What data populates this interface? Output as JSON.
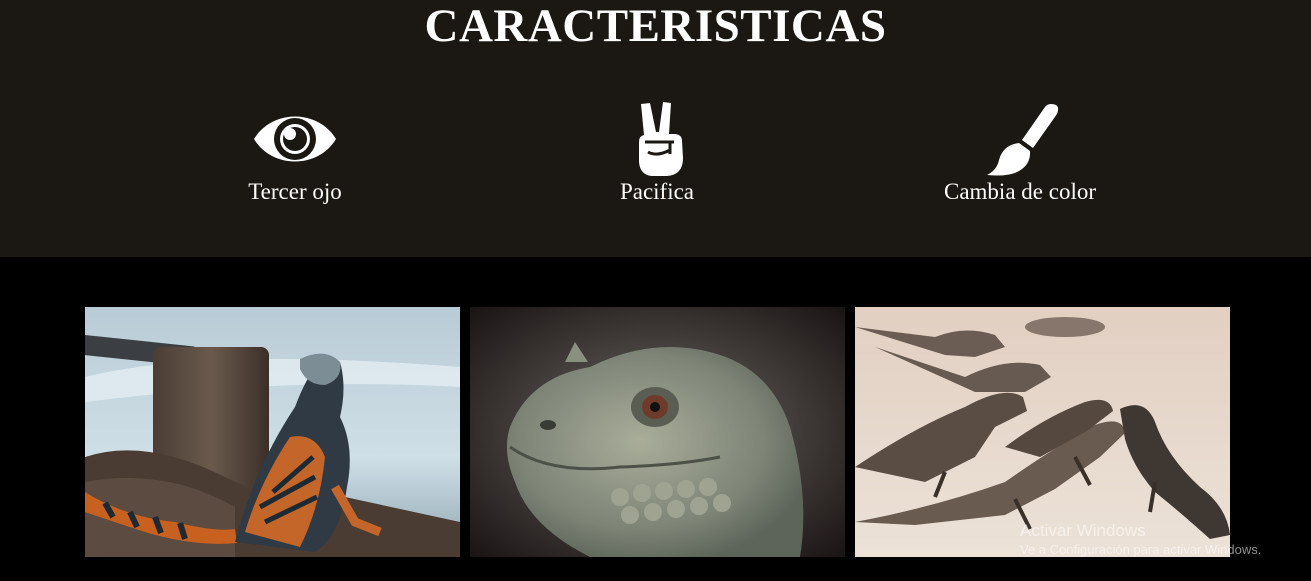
{
  "features_section": {
    "title": "CARACTERISTICAS",
    "items": [
      {
        "icon": "eye-icon",
        "label": "Tercer ojo"
      },
      {
        "icon": "peace-hand-icon",
        "label": "Pacifica"
      },
      {
        "icon": "paint-brush-icon",
        "label": "Cambia de color"
      }
    ],
    "background": "#1b1712",
    "text_color": "#ffffff"
  },
  "gallery": {
    "images": [
      {
        "name": "iguana-by-water-image"
      },
      {
        "name": "iguana-head-closeup-image"
      },
      {
        "name": "iguanas-on-sand-image"
      }
    ],
    "background": "#000000"
  },
  "watermark": {
    "title": "Activar Windows",
    "subtitle": "Ve a Configuración para activar Windows."
  }
}
